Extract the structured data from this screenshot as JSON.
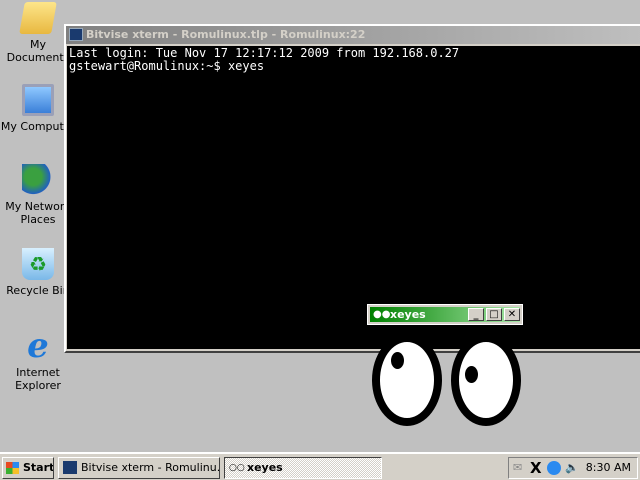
{
  "desktop_icons": [
    {
      "label": "My Documents",
      "icon": "folder-icon"
    },
    {
      "label": "My Computer",
      "icon": "computer-icon"
    },
    {
      "label": "My Network Places",
      "icon": "network-icon"
    },
    {
      "label": "Recycle Bin",
      "icon": "recycle-bin-icon"
    },
    {
      "label": "Internet Explorer",
      "icon": "ie-icon"
    }
  ],
  "xterm": {
    "title": "Bitvise xterm - Romulinux.tlp - Romulinux:22",
    "lines": [
      "Last login: Tue Nov 17 12:17:12 2009 from 192.168.0.27",
      "gstewart@Romulinux:~$ xeyes"
    ]
  },
  "xeyes": {
    "title": "xeyes",
    "minimize": "_",
    "maximize": "□",
    "close": "✕"
  },
  "taskbar": {
    "start": "Start",
    "tasks": [
      "Bitvise xterm - Romulinu...",
      "xeyes"
    ],
    "clock": "8:30 AM"
  }
}
